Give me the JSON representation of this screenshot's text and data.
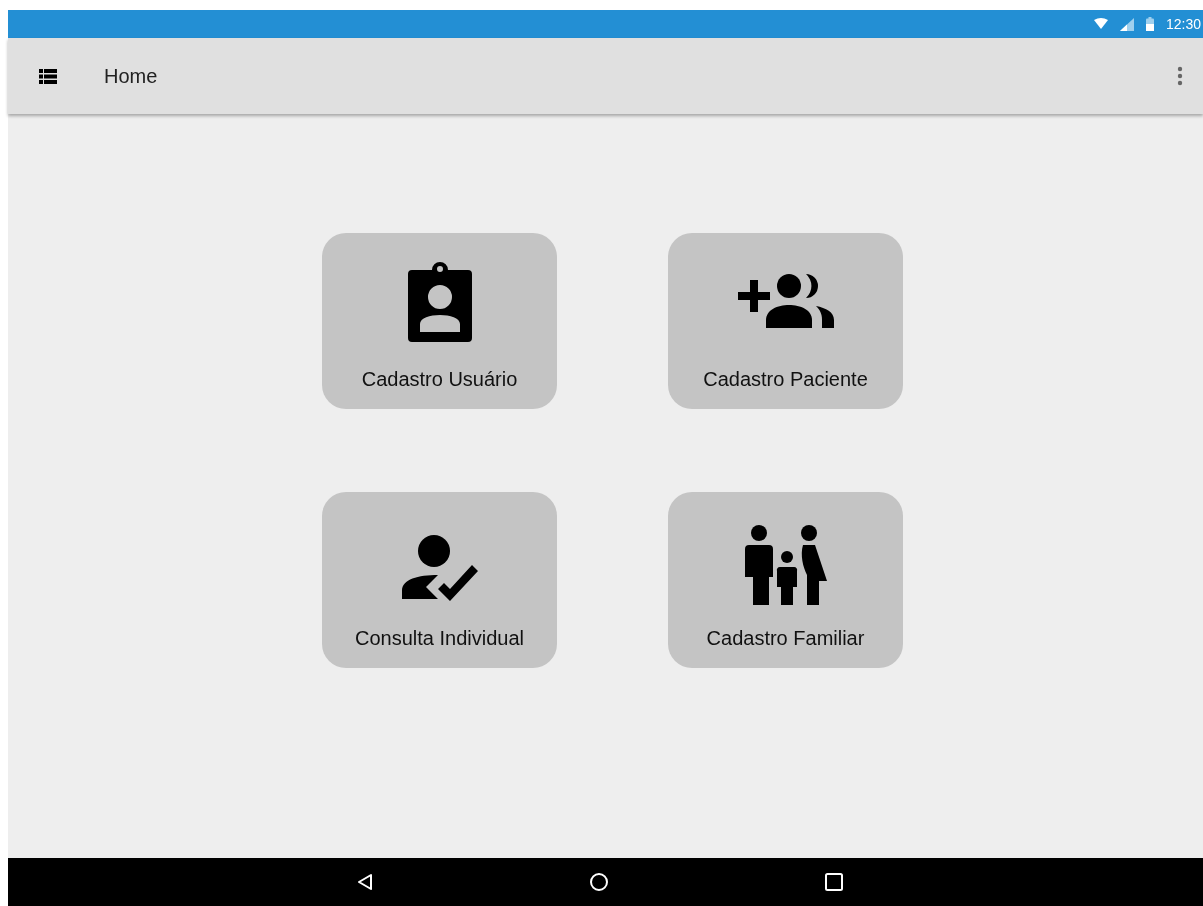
{
  "status_bar": {
    "time": "12:30"
  },
  "app_bar": {
    "title": "Home"
  },
  "cards": [
    {
      "label": "Cadastro Usuário",
      "kind": "badge"
    },
    {
      "label": "Cadastro Paciente",
      "kind": "group-add"
    },
    {
      "label": "Consulta Individual",
      "kind": "person-check"
    },
    {
      "label": "Cadastro Familiar",
      "kind": "family"
    }
  ]
}
